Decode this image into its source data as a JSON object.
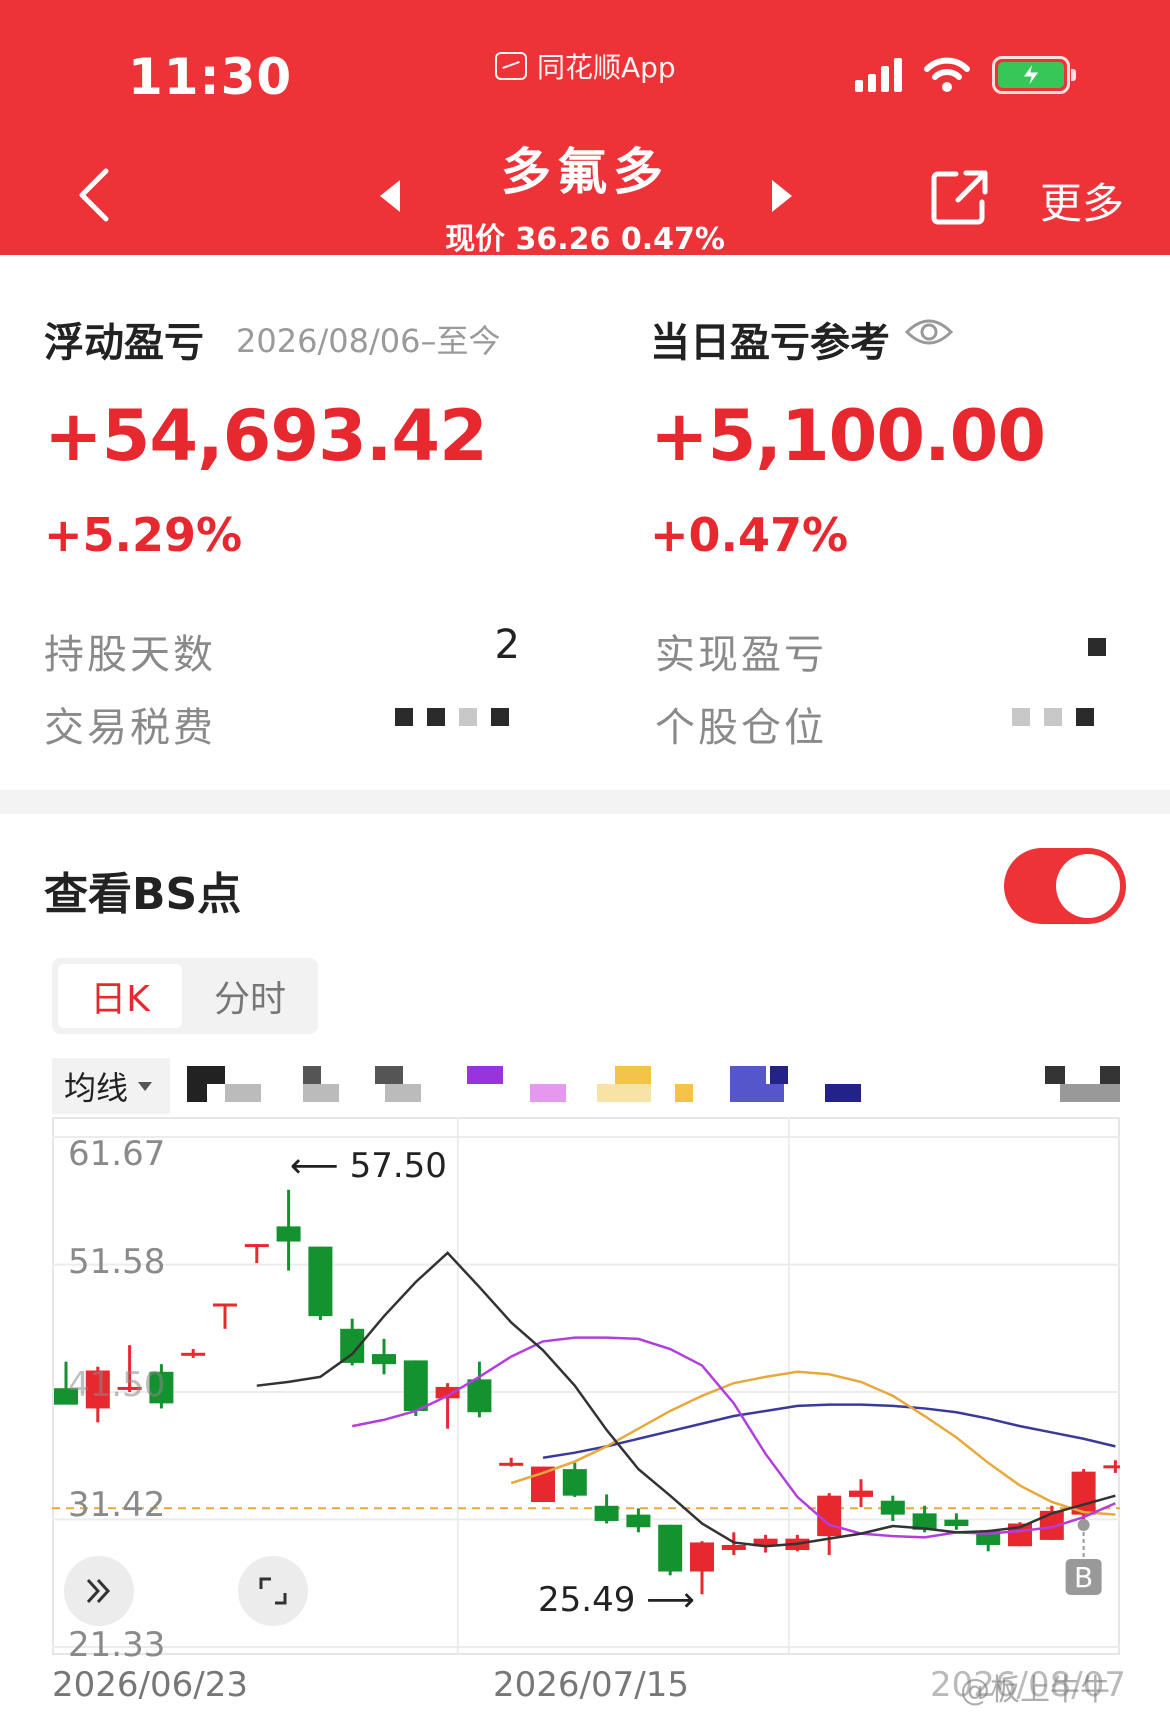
{
  "status_bar": {
    "time": "11:30",
    "app_name": "同花顺App"
  },
  "header": {
    "stock_name": "多氟多",
    "price_line": "现价 36.26 0.47%",
    "more_label": "更多"
  },
  "floating_pl": {
    "label": "浮动盈亏",
    "date_range": "2026/08/06–至今",
    "amount": "+54,693.42",
    "percent": "+5.29%"
  },
  "daily_pl": {
    "label": "当日盈亏参考",
    "amount": "+5,100.00",
    "percent": "+0.47%"
  },
  "stats": {
    "holding_days_label": "持股天数",
    "holding_days_value": "2",
    "tax_label": "交易税费",
    "realized_label": "实现盈亏",
    "position_label": "个股仓位"
  },
  "bs": {
    "title": "查看BS点",
    "toggle_on": true,
    "tabs": [
      "日K",
      "分时"
    ],
    "active_tab": 0,
    "ma_select": "均线"
  },
  "chart_data": {
    "type": "candlestick",
    "y_ticks": [
      "61.67",
      "51.58",
      "41.50",
      "31.42",
      "21.33"
    ],
    "ylim": [
      21.33,
      61.67
    ],
    "x_ticks": [
      "2026/06/23",
      "2026/07/15",
      "2026/08/07"
    ],
    "high_annotation": "57.50",
    "low_annotation": "25.49",
    "buy_marker": "B",
    "reference_line": 32.3,
    "colors": {
      "up": "#e8282f",
      "down": "#14922f",
      "ma5": "#333333",
      "ma10": "#b23ee0",
      "ma20": "#e8a83a",
      "ma60": "#3a3a9a",
      "ref": "#e8a83a"
    },
    "candles": [
      {
        "o": 41.8,
        "h": 43.9,
        "l": 40.6,
        "c": 40.5
      },
      {
        "o": 40.2,
        "h": 43.5,
        "l": 39.1,
        "c": 43.2
      },
      {
        "o": 41.9,
        "h": 45.2,
        "l": 41.5,
        "c": 41.9
      },
      {
        "o": 43.1,
        "h": 43.7,
        "l": 40.2,
        "c": 40.6
      },
      {
        "o": 44.6,
        "h": 44.9,
        "l": 44.2,
        "c": 44.6
      },
      {
        "o": 48.4,
        "h": 48.5,
        "l": 46.5,
        "c": 48.5
      },
      {
        "o": 53.0,
        "h": 53.2,
        "l": 51.7,
        "c": 53.2
      },
      {
        "o": 54.6,
        "h": 57.5,
        "l": 51.1,
        "c": 53.4
      },
      {
        "o": 53.0,
        "h": 53.0,
        "l": 47.2,
        "c": 47.5
      },
      {
        "o": 46.5,
        "h": 47.3,
        "l": 43.6,
        "c": 43.8
      },
      {
        "o": 44.5,
        "h": 45.7,
        "l": 42.9,
        "c": 43.7
      },
      {
        "o": 44.0,
        "h": 44.0,
        "l": 39.6,
        "c": 40.0
      },
      {
        "o": 41.0,
        "h": 42.2,
        "l": 38.6,
        "c": 41.9
      },
      {
        "o": 42.5,
        "h": 43.9,
        "l": 39.5,
        "c": 39.9
      },
      {
        "o": 35.9,
        "h": 36.3,
        "l": 35.6,
        "c": 35.9
      },
      {
        "o": 32.8,
        "h": 35.6,
        "l": 32.8,
        "c": 35.6
      },
      {
        "o": 35.4,
        "h": 35.9,
        "l": 33.2,
        "c": 33.3
      },
      {
        "o": 32.5,
        "h": 33.4,
        "l": 31.1,
        "c": 31.3
      },
      {
        "o": 31.8,
        "h": 32.3,
        "l": 30.4,
        "c": 30.8
      },
      {
        "o": 31.0,
        "h": 31.0,
        "l": 27.0,
        "c": 27.3
      },
      {
        "o": 27.3,
        "h": 29.7,
        "l": 25.5,
        "c": 29.6
      },
      {
        "o": 29.0,
        "h": 30.4,
        "l": 28.6,
        "c": 29.4
      },
      {
        "o": 29.3,
        "h": 30.2,
        "l": 28.8,
        "c": 29.9
      },
      {
        "o": 29.0,
        "h": 30.2,
        "l": 28.9,
        "c": 29.9
      },
      {
        "o": 30.1,
        "h": 33.5,
        "l": 28.6,
        "c": 33.3
      },
      {
        "o": 33.2,
        "h": 34.6,
        "l": 32.4,
        "c": 33.7
      },
      {
        "o": 32.9,
        "h": 33.3,
        "l": 31.3,
        "c": 31.8
      },
      {
        "o": 31.9,
        "h": 32.5,
        "l": 30.4,
        "c": 30.6
      },
      {
        "o": 31.4,
        "h": 31.9,
        "l": 30.6,
        "c": 30.9
      },
      {
        "o": 30.5,
        "h": 30.6,
        "l": 28.9,
        "c": 29.4
      },
      {
        "o": 29.3,
        "h": 31.2,
        "l": 29.3,
        "c": 31.1
      },
      {
        "o": 29.8,
        "h": 32.5,
        "l": 29.8,
        "c": 32.1
      },
      {
        "o": 31.8,
        "h": 35.4,
        "l": 31.3,
        "c": 35.2
      },
      {
        "o": 35.5,
        "h": 36.1,
        "l": 35.1,
        "c": 35.7
      }
    ],
    "ma5": [
      42.0,
      42.3,
      42.7,
      44.5,
      47.5,
      50.2,
      52.5,
      49.8,
      47.0,
      44.8,
      42.0,
      38.5,
      35.4,
      33.3,
      31.1,
      29.6,
      29.3,
      29.5,
      29.9,
      30.3,
      30.9,
      30.7,
      30.4,
      30.5,
      30.8,
      31.9,
      32.6,
      33.3
    ],
    "ma10": [
      38.8,
      39.3,
      40.0,
      41.2,
      42.7,
      44.3,
      45.5,
      45.8,
      45.8,
      45.7,
      44.9,
      43.6,
      40.6,
      36.6,
      33.2,
      31.0,
      30.3,
      30.1,
      30.0,
      30.4,
      30.3,
      30.5,
      30.8,
      31.6,
      32.7
    ],
    "ma20": [
      34.3,
      35.1,
      36.0,
      37.2,
      38.6,
      40.0,
      41.2,
      42.2,
      42.7,
      43.1,
      42.9,
      42.3,
      41.2,
      39.6,
      37.9,
      35.9,
      34.1,
      32.8,
      32.0,
      31.8
    ],
    "ma60": [
      36.3,
      36.7,
      37.2,
      37.8,
      38.4,
      39.0,
      39.6,
      40.0,
      40.4,
      40.5,
      40.5,
      40.4,
      40.2,
      39.9,
      39.4,
      38.8,
      38.3,
      37.8,
      37.2
    ]
  }
}
